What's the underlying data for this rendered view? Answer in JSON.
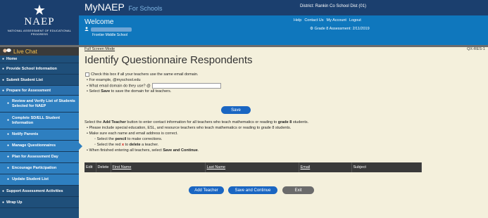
{
  "logo": {
    "star": "★",
    "name": "NAEP",
    "subtitle": "NATIONAL ASSESSMENT OF EDUCATIONAL PROGRESS"
  },
  "app": {
    "title": "MyNAEP",
    "title_suffix": "For Schools"
  },
  "header": {
    "district": "District: Rankin Co School Dist (01)",
    "welcome": "Welcome",
    "school": "Frontier Middle School",
    "links": [
      "Help",
      "Contact Us",
      "My Account",
      "Logout"
    ],
    "grade_info": "Grade 8 Assessment: 2/11/2019"
  },
  "sidebar": {
    "live_chat": "Live Chat",
    "items": [
      {
        "label": "Home",
        "kind": "main"
      },
      {
        "label": "Provide School Information",
        "kind": "main"
      },
      {
        "label": "Submit Student List",
        "kind": "main"
      },
      {
        "label": "Prepare for Assessment",
        "kind": "section"
      },
      {
        "label": "Review and Verify List of Students Selected for NAEP",
        "kind": "sub"
      },
      {
        "label": "Complete SD/ELL Student Information",
        "kind": "sub"
      },
      {
        "label": "Notify Parents",
        "kind": "sub"
      },
      {
        "label": "Manage Questionnaires",
        "kind": "sub-active"
      },
      {
        "label": "Plan for Assessment Day",
        "kind": "sub"
      },
      {
        "label": "Encourage Participation",
        "kind": "sub"
      },
      {
        "label": "Update Student List",
        "kind": "sub"
      },
      {
        "label": "Support Assessment Activities",
        "kind": "main"
      },
      {
        "label": "Wrap Up",
        "kind": "main"
      }
    ]
  },
  "main": {
    "full_screen": "Full Screen Mode",
    "screen_id": "QX-RES-1",
    "title": "Identify Questionnaire Respondents",
    "checkbox_label": "Check this box if all your teachers use the same email domain.",
    "example": "For example, @myschool.edu",
    "domain_question": "What email domain do they use? @",
    "domain_value": "",
    "save_instruction_pre": "Select ",
    "save_instruction_bold": "Save",
    "save_instruction_post": " to save the domain for all teachers.",
    "save_button": "Save",
    "instr_pre": "Select the ",
    "instr_add": "Add Teacher",
    "instr_mid": " button to enter contact information for all teachers who teach mathematics or reading to ",
    "instr_grade": "grade 8",
    "instr_post": " students.",
    "bullet_1": "Please include special education, ESL, and resource teachers who teach mathematics or reading to grade 8 students.",
    "bullet_2": "Make sure each name and email address is correct.",
    "sub_1_pre": "Select the ",
    "sub_1_bold": "pencil",
    "sub_1_post": " to make corrections.",
    "sub_2_pre": "Select the red ",
    "sub_2_x": "x",
    "sub_2_mid": " to ",
    "sub_2_bold": "delete",
    "sub_2_post": " a teacher.",
    "bullet_3_pre": "When finished entering all teachers, select ",
    "bullet_3_bold": "Save and Continue",
    "bullet_3_post": ".",
    "table_headers": [
      "Edit",
      "Delete",
      "First Name",
      "Last Name",
      "Email",
      "Subject"
    ],
    "buttons": {
      "add_teacher": "Add Teacher",
      "save_continue": "Save and Continue",
      "exit": "Exit"
    }
  },
  "colors": {
    "header_dark": "#1b3f6e",
    "header_blue": "#0f77bd",
    "sidebar": "#1f4f7a",
    "button_blue": "#1a66c2",
    "background": "#f4f0dc"
  }
}
